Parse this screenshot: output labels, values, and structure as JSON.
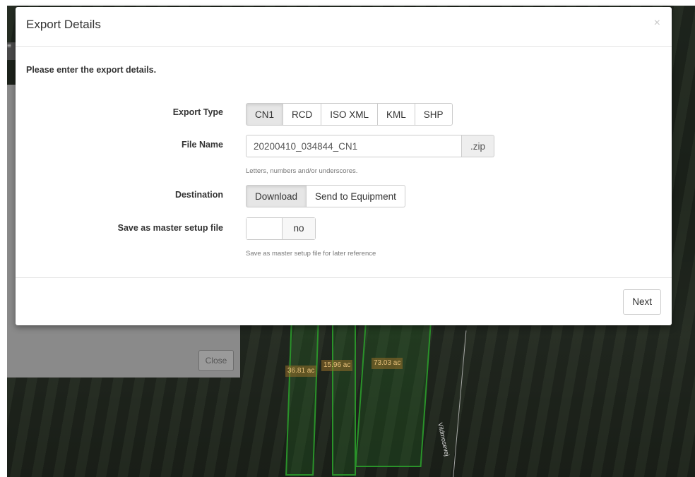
{
  "modal": {
    "title": "Export Details",
    "close_glyph": "×",
    "intro": "Please enter the export details.",
    "export_type": {
      "label": "Export Type",
      "options": [
        "CN1",
        "RCD",
        "ISO XML",
        "KML",
        "SHP"
      ],
      "selected": "CN1"
    },
    "file_name": {
      "label": "File Name",
      "value": "20200410_034844_CN1",
      "suffix": ".zip",
      "help": "Letters, numbers and/or underscores."
    },
    "destination": {
      "label": "Destination",
      "options": [
        "Download",
        "Send to Equipment"
      ],
      "selected": "Download"
    },
    "master_setup": {
      "label": "Save as master setup file",
      "state": "no",
      "help": "Save as master setup file for later reference"
    },
    "next_label": "Next"
  },
  "background": {
    "close_label": "Close",
    "acre_labels": [
      "36.81 ac",
      "15.96 ac",
      "73.03 ac"
    ],
    "road_label": "Vildmosevej"
  },
  "colors": {
    "field_outline": "#41e141",
    "active_button": "#e6e6e6"
  }
}
